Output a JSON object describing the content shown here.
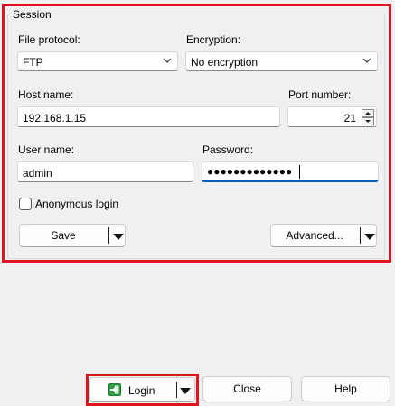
{
  "session": {
    "group_title": "Session",
    "file_protocol": {
      "label": "File protocol:",
      "value": "FTP",
      "icon": "chevron-down-icon"
    },
    "encryption": {
      "label": "Encryption:",
      "value": "No encryption",
      "icon": "chevron-down-icon"
    },
    "host_name": {
      "label": "Host name:",
      "value": "192.168.1.15"
    },
    "port_number": {
      "label": "Port number:",
      "value": "21"
    },
    "user_name": {
      "label": "User name:",
      "value": "admin"
    },
    "password": {
      "label": "Password:",
      "value": "●●●●●●●●●●●●●"
    },
    "anonymous_login": {
      "label": "Anonymous login",
      "checked": false
    },
    "save_button": "Save",
    "advanced_button": "Advanced..."
  },
  "footer": {
    "login_button": "Login",
    "login_icon": "login-icon",
    "close_button": "Close",
    "help_button": "Help"
  },
  "colors": {
    "highlight_red": "#e0141e",
    "focus_blue": "#005fb8",
    "background": "#f0f0f0",
    "login_icon_green": "#2ea043"
  }
}
